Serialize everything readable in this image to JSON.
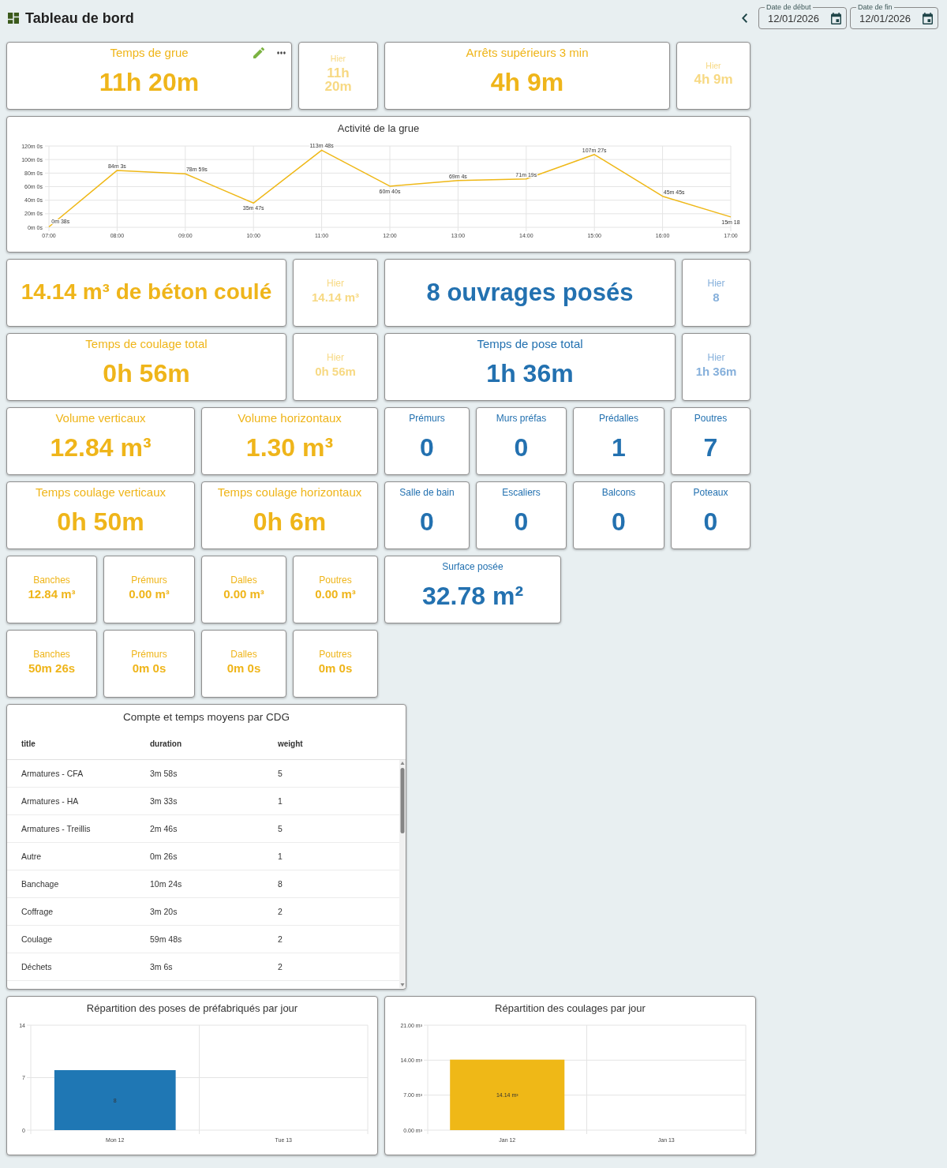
{
  "header": {
    "title": "Tableau de bord",
    "date_fields": [
      {
        "label": "Date de début",
        "value": "12/01/2026"
      },
      {
        "label": "Date de fin",
        "value": "12/01/2026"
      }
    ]
  },
  "top_row": {
    "cards": [
      {
        "kind": "metric",
        "title": "Temps de grue",
        "value": "11h 20m",
        "color": "#efb51a",
        "editable": true
      },
      {
        "kind": "compact",
        "title": "Hier",
        "value": "11h 20m",
        "color": "#f7d983",
        "editable": false
      },
      {
        "kind": "metric",
        "title": "Arrêts supérieurs 3 min",
        "value": "4h 9m",
        "color": "#efb51a",
        "editable": false
      },
      {
        "kind": "compact",
        "title": "Hier",
        "value": "4h 9m",
        "color": "#f7d983",
        "editable": false
      }
    ]
  },
  "activity_chart": {
    "title": "Activité de la grue",
    "y_axis_labels": [
      "120m 0s",
      "100m 0s",
      "80m 0s",
      "60m 0s",
      "40m 0s",
      "20m 0s",
      "0m 0s"
    ],
    "x_axis_labels": [
      "07:00",
      "08:00",
      "09:00",
      "10:00",
      "11:00",
      "12:00",
      "13:00",
      "14:00",
      "15:00",
      "16:00",
      "17:00"
    ],
    "point_labels": [
      "0m 38s",
      "84m 3s",
      "78m 59s",
      "35m 47s",
      "113m 48s",
      "60m 40s",
      "69m 4s",
      "71m 19s",
      "107m 27s",
      "45m 45s",
      "15m 18"
    ]
  },
  "card_rows": [
    {
      "cards": [
        {
          "kind": "metric",
          "value": "14.14 m³ de béton coulé",
          "color": "#efb51a"
        },
        {
          "kind": "compact",
          "title": "Hier",
          "value": "14.14 m³",
          "color": "#f7d983"
        },
        {
          "kind": "metric",
          "value": "8 ouvrages posés",
          "color": "#2371b0"
        },
        {
          "kind": "compact",
          "title": "Hier",
          "value": "8",
          "color": "#86b0db"
        }
      ]
    },
    {
      "cards": [
        {
          "kind": "metric",
          "title": "Temps de coulage total",
          "value": "0h 56m",
          "color": "#efb51a"
        },
        {
          "kind": "compact",
          "title": "Hier",
          "value": "0h 56m",
          "color": "#f7d983"
        },
        {
          "kind": "metric",
          "title": "Temps de pose total",
          "value": "1h 36m",
          "color": "#2371b0"
        },
        {
          "kind": "compact",
          "title": "Hier",
          "value": "1h 36m",
          "color": "#86b0db"
        }
      ]
    },
    {
      "cards": [
        {
          "kind": "metric",
          "title": "Volume verticaux",
          "value": "12.84 m³",
          "color": "#efb51a"
        },
        {
          "kind": "metric",
          "title": "Volume horizontaux",
          "value": "1.30 m³",
          "color": "#efb51a"
        },
        {
          "kind": "metric",
          "title": "Prémurs",
          "value": "0",
          "color": "#2371b0"
        },
        {
          "kind": "metric",
          "title": "Murs préfas",
          "value": "0",
          "color": "#2371b0"
        },
        {
          "kind": "metric",
          "title": "Prédalles",
          "value": "1",
          "color": "#2371b0"
        },
        {
          "kind": "metric",
          "title": "Poutres",
          "value": "7",
          "color": "#2371b0"
        }
      ]
    },
    {
      "cards": [
        {
          "kind": "metric",
          "title": "Temps coulage verticaux",
          "value": "0h 50m",
          "color": "#efb51a"
        },
        {
          "kind": "metric",
          "title": "Temps coulage horizontaux",
          "value": "0h 6m",
          "color": "#efb51a"
        },
        {
          "kind": "metric",
          "title": "Salle de bain",
          "value": "0",
          "color": "#2371b0"
        },
        {
          "kind": "metric",
          "title": "Escaliers",
          "value": "0",
          "color": "#2371b0"
        },
        {
          "kind": "metric",
          "title": "Balcons",
          "value": "0",
          "color": "#2371b0"
        },
        {
          "kind": "metric",
          "title": "Poteaux",
          "value": "0",
          "color": "#2371b0"
        }
      ]
    },
    {
      "cards": [
        {
          "kind": "compact",
          "title": "Banches",
          "value": "12.84 m³",
          "color": "#efb51a"
        },
        {
          "kind": "compact",
          "title": "Prémurs",
          "value": "0.00 m³",
          "color": "#efb51a"
        },
        {
          "kind": "compact",
          "title": "Dalles",
          "value": "0.00 m³",
          "color": "#efb51a"
        },
        {
          "kind": "compact",
          "title": "Poutres",
          "value": "0.00 m³",
          "color": "#efb51a"
        },
        {
          "kind": "metric",
          "title": "Surface posée",
          "value": "32.78 m²",
          "color": "#2371b0"
        }
      ]
    },
    {
      "cards": [
        {
          "kind": "compact",
          "title": "Banches",
          "value": "50m 26s",
          "color": "#efb51a"
        },
        {
          "kind": "compact",
          "title": "Prémurs",
          "value": "0m 0s",
          "color": "#efb51a"
        },
        {
          "kind": "compact",
          "title": "Dalles",
          "value": "0m 0s",
          "color": "#efb51a"
        },
        {
          "kind": "compact",
          "title": "Poutres",
          "value": "0m 0s",
          "color": "#efb51a"
        }
      ]
    }
  ],
  "cdg_table": {
    "title": "Compte et temps moyens par CDG",
    "columns": [
      "title",
      "duration",
      "weight"
    ],
    "rows": [
      [
        "Armatures - CFA",
        "3m 58s",
        "5"
      ],
      [
        "Armatures - HA",
        "3m 33s",
        "1"
      ],
      [
        "Armatures - Treillis",
        "2m 46s",
        "5"
      ],
      [
        "Autre",
        "0m 26s",
        "1"
      ],
      [
        "Banchage",
        "10m 24s",
        "8"
      ],
      [
        "Coffrage",
        "3m 20s",
        "2"
      ],
      [
        "Coulage",
        "59m 48s",
        "2"
      ],
      [
        "Déchets",
        "3m 6s",
        "2"
      ]
    ]
  },
  "bottom_charts": [
    {
      "chart_data": {
        "type": "bar",
        "title": "Répartition des poses de préfabriqués par jour",
        "categories": [
          "Mon 12",
          "Tue 13"
        ],
        "grid": true,
        "series": [
          {
            "color": "#1f77b4",
            "values": [
              8,
              0
            ]
          }
        ],
        "ylim": [
          0,
          14
        ],
        "yticks": [
          0,
          7,
          14
        ],
        "value_labels": [
          "8",
          null
        ]
      }
    },
    {
      "chart_data": {
        "type": "bar",
        "title": "Répartition des coulages par jour",
        "categories": [
          "Jan 12",
          "Jan 13"
        ],
        "grid": true,
        "series": [
          {
            "color": "#efb817",
            "values": [
              14.1,
              0
            ]
          }
        ],
        "ylim": [
          0,
          21
        ],
        "yticks": [
          {
            "value": 0,
            "label": "0.00 m³"
          },
          {
            "value": 7,
            "label": "7.00 m³"
          },
          {
            "value": 14,
            "label": "14.00 m³"
          },
          {
            "value": 21,
            "label": "21.00 m³"
          }
        ],
        "value_labels": [
          "14.14 m³",
          null
        ]
      }
    }
  ]
}
